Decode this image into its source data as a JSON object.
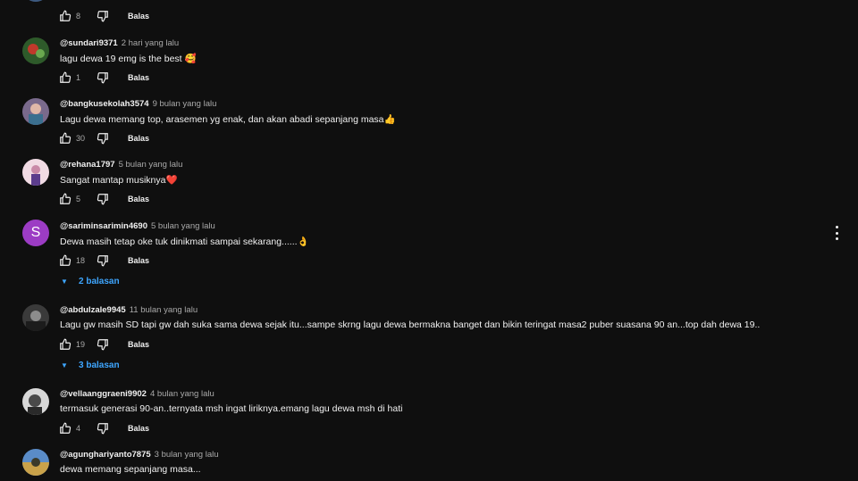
{
  "comments": [
    {
      "handle": "@sundari9371",
      "time": "2 hari yang lalu",
      "text": "lagu dewa 19 emg is the best 🥰",
      "likes": "1",
      "reply_label": "Balas",
      "avatar_color": "#4a7a3a"
    },
    {
      "handle": "@bangkusekolah3574",
      "time": "9 bulan yang lalu",
      "text": "Lagu dewa memang top, arasemen yg enak, dan akan abadi sepanjang masa👍",
      "likes": "30",
      "reply_label": "Balas",
      "avatar_color": "#8a6a8a"
    },
    {
      "handle": "@rehana1797",
      "time": "5 bulan yang lalu",
      "text": "Sangat mantap musiknya❤️",
      "likes": "5",
      "reply_label": "Balas",
      "avatar_color": "#d9b3c9"
    },
    {
      "handle": "@sariminsarimin4690",
      "time": "5 bulan yang lalu",
      "text": "Dewa masih tetap oke tuk dinikmati sampai sekarang......👌",
      "likes": "18",
      "reply_label": "Balas",
      "avatar_color": "#9c3cc4",
      "avatar_letter": "S",
      "replies_label": "2 balasan"
    },
    {
      "handle": "@abdulzale9945",
      "time": "11 bulan yang lalu",
      "text": "Lagu gw masih SD tapi gw dah suka sama dewa sejak itu...sampe skrng lagu dewa bermakna banget dan bikin teringat masa2 puber suasana 90 an...top dah dewa 19..",
      "likes": "19",
      "reply_label": "Balas",
      "avatar_color": "#5a5a5a",
      "replies_label": "3 balasan"
    },
    {
      "handle": "@vellaanggraeni9902",
      "time": "4 bulan yang lalu",
      "text": "termasuk generasi 90-an..ternyata msh ingat liriknya.emang lagu dewa msh di hati",
      "likes": "4",
      "reply_label": "Balas",
      "avatar_color": "#6b6b6b"
    },
    {
      "handle": "@agunghariyanto7875",
      "time": "3 bulan yang lalu",
      "text": "dewa memang sepanjang masa...",
      "avatar_color": "#c9a24a"
    }
  ],
  "top_partial": {
    "likes": "8",
    "reply_label": "Balas"
  },
  "icons": {
    "like": "thumb-up-icon",
    "dislike": "thumb-down-icon",
    "expand": "caret-down-icon",
    "more": "more-vert-icon"
  }
}
